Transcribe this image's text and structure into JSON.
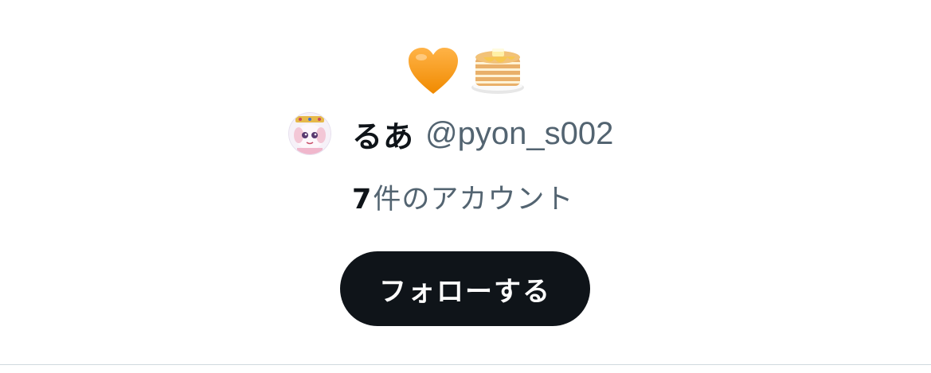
{
  "profile": {
    "bio_emojis": [
      "heart-orange",
      "pancakes"
    ],
    "display_name": "るあ",
    "handle": "@pyon_s002",
    "avatar": "avatar-illustration"
  },
  "account_count": {
    "number": "7",
    "label": "件のアカウント"
  },
  "actions": {
    "follow_label": "フォローする"
  },
  "colors": {
    "primary_text": "#0f1419",
    "secondary_text": "#536471",
    "button_bg": "#0f1419",
    "button_text": "#ffffff",
    "divider": "#cfd9de",
    "heart": "#f4900c"
  }
}
